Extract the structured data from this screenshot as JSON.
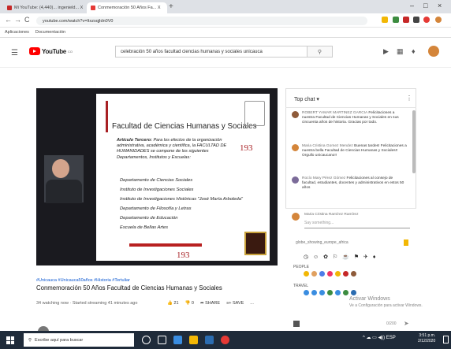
{
  "browser": {
    "tabs": [
      {
        "label": "Mi YouTube: (4,440)... ingenield... X",
        "color": "#c62828"
      },
      {
        "label": "Conmemoración 50 Años Fa... X",
        "color": "#e53935"
      }
    ],
    "new_tab": "+",
    "window_controls": [
      "–",
      "□",
      "×"
    ],
    "nav": {
      "back": "←",
      "forward": "→",
      "reload": "C"
    },
    "url": "youtube.com/watch?v=ItxzsqjIdn0V0",
    "bookmarks": [
      "Aplicaciones",
      "Documentación"
    ]
  },
  "youtube": {
    "logo_text": "YouTube",
    "logo_superscript": "CO",
    "search_query": "celebración 50 años facultad ciencias humanas y sociales unicauca",
    "search_icon": "search-icon",
    "header_icons": [
      "create-video-icon",
      "apps-grid-icon",
      "notifications-icon"
    ]
  },
  "slide": {
    "title": "Facultad de Ciencias Humanas y Sociales",
    "article_label": "Artículo Tercero:",
    "article_text": "Para los efectos de la organización administrativa, académica y científica, la FACULTAD DE HUMANIDADES se compone de los siguientes Departamentos, Institutos y Escuelas:",
    "number": "193",
    "departments": [
      "Departamento de Ciencias Sociales",
      "Instituto de Investigaciones Sociales",
      "Instituto de Investigaciones Históricas \"José María Arboleda\"",
      "Departamento de Filosofía y Letras",
      "Departamento de Educación",
      "Escuela de Bellas Artes"
    ],
    "number_bottom": "193"
  },
  "video": {
    "tags": "#Unicauca #Unicauca50años #Historia #Tertuliar",
    "title": "Conmemoración 50 Años Facultad de Ciencias Humanas y Sociales",
    "meta": "34 watching now · Started streaming 41 minutes ago",
    "likes": "21",
    "dislikes": "0",
    "share": "SHARE",
    "save": "SAVE",
    "more": "..."
  },
  "chat": {
    "header": "Top chat",
    "menu": "⋮",
    "messages": [
      {
        "author": "ROBERT YAMAR MARTINEZ GARCIA",
        "text": "Felicitaciones a nuestra Facultad de Ciencias Humanas y Sociales en sus cincuenta años de historia. Gracias por todo.",
        "avatar_color": "#8e5b3a"
      },
      {
        "author": "Maria Cristina Gomez Mendez",
        "text": "Buenas tardes! Felicitaciones a nuestra bella Facultad de Ciencias Humanas y Sociales!! Orgullo unicaucano!!",
        "avatar_color": "#d4853a"
      },
      {
        "author": "Rocío Mary Pérez Gómez",
        "text": "Felicitaciones al consejo de facultad, estudiantes, docentes y administrativos en estos 50 años",
        "avatar_color": "#7b6b99"
      }
    ],
    "my_name": "Maria Cristina Ramírez Ramírez",
    "say_placeholder": "Say something...",
    "emoji_topic": "globe_showing_europe_africa",
    "sections": [
      "PEOPLE",
      "TRAVEL"
    ],
    "watermark_title": "Activar Windows",
    "watermark_sub": "Ve a Configuración para activar Windows.",
    "counter": "0/200"
  },
  "taskbar": {
    "search_placeholder": "Escribe aquí para buscar",
    "time": "3:51 p.m.",
    "date": "2/12/2020"
  },
  "colors": {
    "yt_red": "#ff0000",
    "slide_red": "#a82024",
    "taskbar_bg": "#1f2b3a"
  }
}
